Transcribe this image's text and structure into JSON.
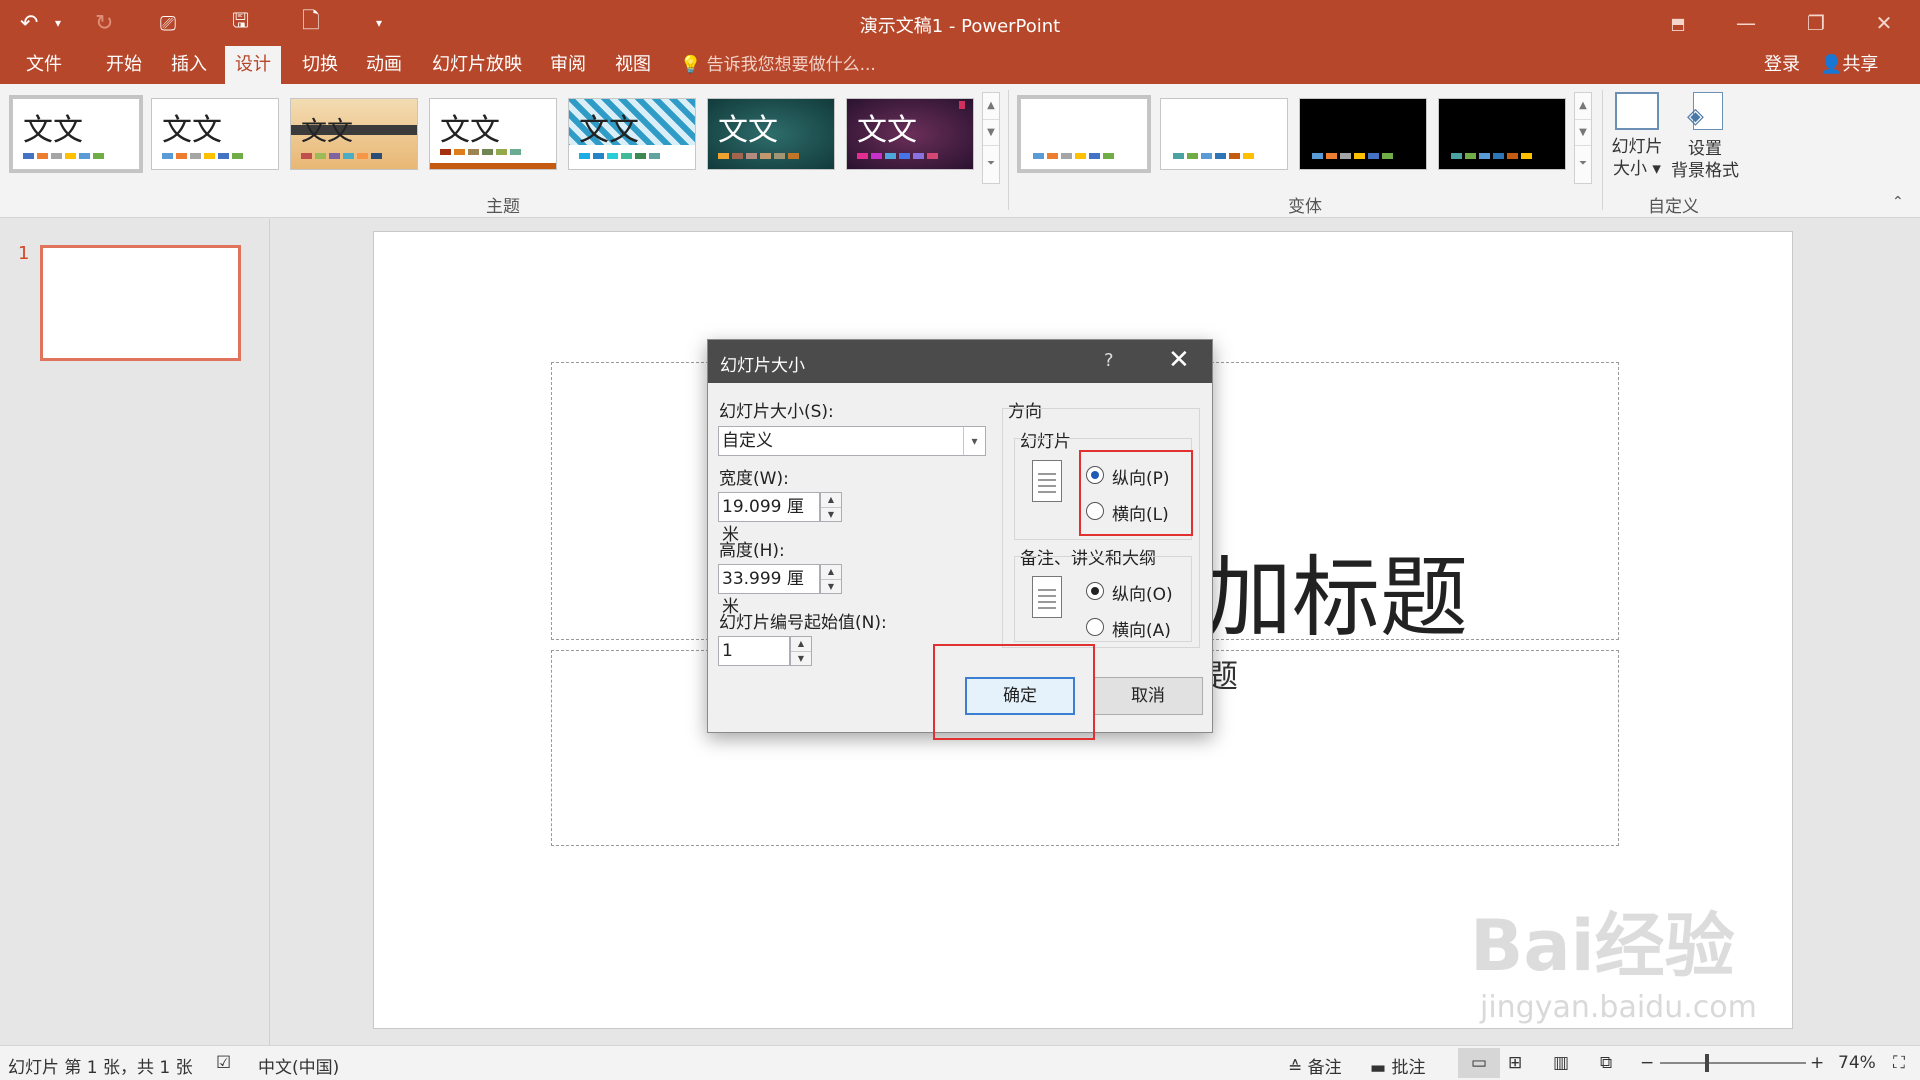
{
  "window": {
    "title": "演示文稿1 - PowerPoint"
  },
  "tabs": [
    "文件",
    "开始",
    "插入",
    "设计",
    "切换",
    "动画",
    "幻灯片放映",
    "审阅",
    "视图"
  ],
  "active_tab": "设计",
  "tell_me": "告诉我您想要做什么...",
  "account": {
    "login": "登录",
    "share": "共享"
  },
  "ribbon": {
    "themes_label": "主题",
    "theme_sample": "文文",
    "variants_label": "变体",
    "customize_label": "自定义",
    "slide_size_line1": "幻灯片",
    "slide_size_line2": "大小",
    "format_bg_line1": "设置",
    "format_bg_line2": "背景格式"
  },
  "thumbnail": {
    "number": "1"
  },
  "slide": {
    "title_visible": "加标题",
    "subtitle_visible": "题"
  },
  "dialog": {
    "title": "幻灯片大小",
    "help": "?",
    "size_label": "幻灯片大小(S):",
    "size_value": "自定义",
    "width_label": "宽度(W):",
    "width_value": "19.099 厘米",
    "height_label": "高度(H):",
    "height_value": "33.999 厘米",
    "start_label": "幻灯片编号起始值(N):",
    "start_value": "1",
    "orientation_label": "方向",
    "slides_label": "幻灯片",
    "slides_portrait": "纵向(P)",
    "slides_landscape": "横向(L)",
    "notes_label": "备注、讲义和大纲",
    "notes_portrait": "纵向(O)",
    "notes_landscape": "横向(A)",
    "ok": "确定",
    "cancel": "取消"
  },
  "status": {
    "slide_info": "幻灯片 第 1 张，共 1 张",
    "language": "中文(中国)",
    "notes": "备注",
    "comments": "批注",
    "zoom": "74%"
  },
  "watermark": {
    "main": "Bai经验",
    "sub": "jingyan.baidu.com"
  },
  "colors": {
    "accent": "#b7472a",
    "selection": "#e03030"
  }
}
